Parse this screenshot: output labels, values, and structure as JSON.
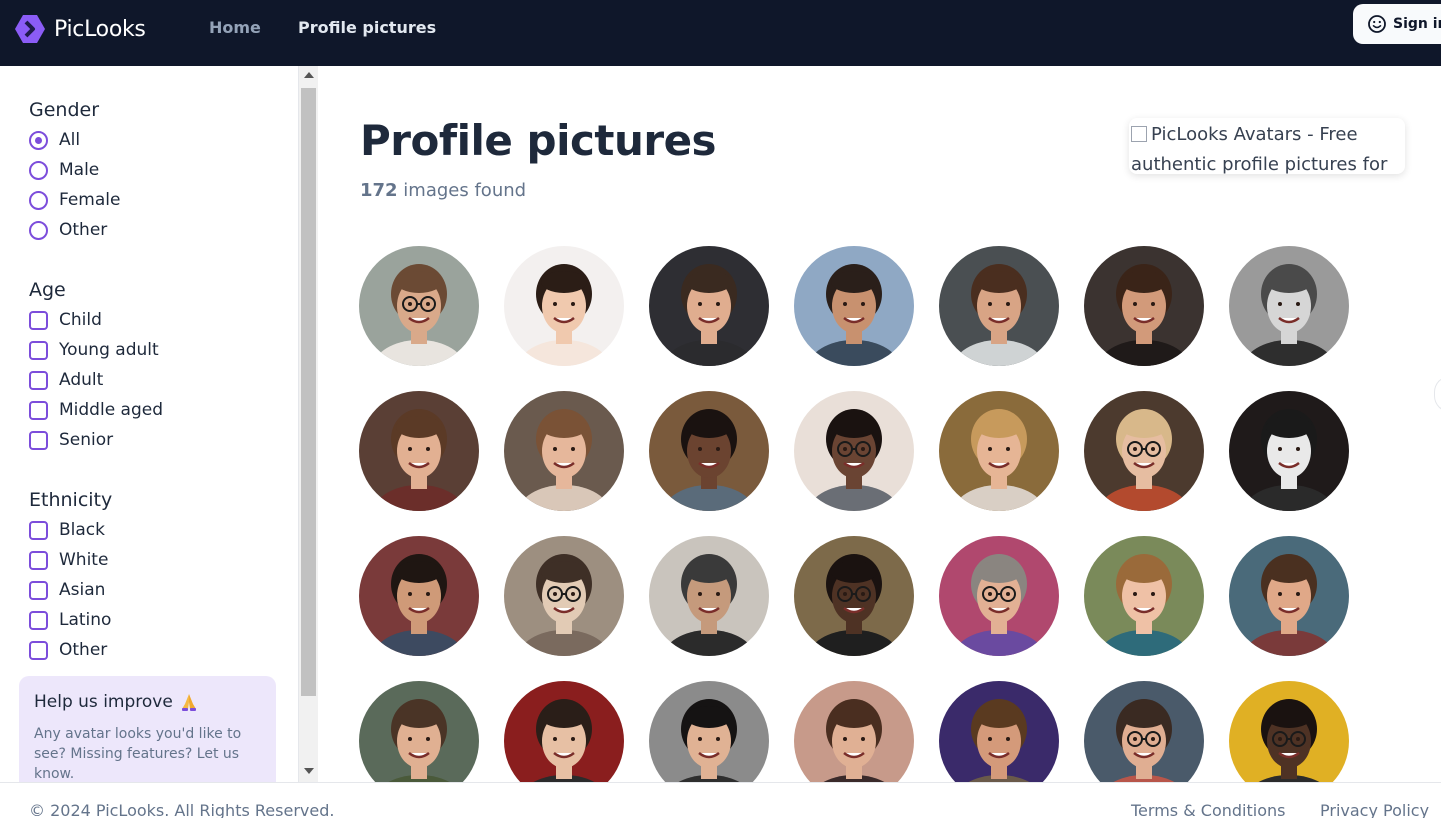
{
  "header": {
    "brand": "PicLooks",
    "nav": [
      {
        "label": "Home"
      },
      {
        "label": "Profile pictures"
      }
    ],
    "signin_label": "Sign in"
  },
  "sidebar": {
    "gender": {
      "title": "Gender",
      "options": [
        "All",
        "Male",
        "Female",
        "Other"
      ],
      "selected": "All"
    },
    "age": {
      "title": "Age",
      "options": [
        "Child",
        "Young adult",
        "Adult",
        "Middle aged",
        "Senior"
      ]
    },
    "ethnicity": {
      "title": "Ethnicity",
      "options": [
        "Black",
        "White",
        "Asian",
        "Latino",
        "Other"
      ]
    },
    "help": {
      "title": "Help us improve",
      "text": "Any avatar looks you'd like to see? Missing features? Let us know."
    }
  },
  "main": {
    "title": "Profile pictures",
    "count": "172",
    "count_suffix": " images found",
    "broken_image_alt": "PicLooks Avatars - Free authentic profile pictures for"
  },
  "avatars": [
    {
      "bg": "#9aa39c",
      "skin": "#d9a98a",
      "hair": "#6b4a34",
      "shirt": "#e8e4df",
      "glasses": true
    },
    {
      "bg": "#f3f0ef",
      "skin": "#f0c9ae",
      "hair": "#2b1d16",
      "shirt": "#f5e6dc",
      "glasses": false
    },
    {
      "bg": "#2e2e33",
      "skin": "#e0ad8f",
      "hair": "#3a2a20",
      "shirt": "#2b2b2e",
      "glasses": false
    },
    {
      "bg": "#8fa8c4",
      "skin": "#c8916f",
      "hair": "#2a1f1a",
      "shirt": "#3a4b5d",
      "glasses": false
    },
    {
      "bg": "#4a4f52",
      "skin": "#d8a485",
      "hair": "#4a2e1f",
      "shirt": "#cfd3d4",
      "glasses": false
    },
    {
      "bg": "#3b3330",
      "skin": "#d29a7a",
      "hair": "#3a2418",
      "shirt": "#1f1a19",
      "glasses": false
    },
    {
      "bg": "#9a9a9a",
      "skin": "#d6d6d6",
      "hair": "#4a4a4a",
      "shirt": "#2e2e2e",
      "glasses": false
    },
    {
      "bg": "#5a3f35",
      "skin": "#e2b092",
      "hair": "#5b3a26",
      "shirt": "#6b2e2a",
      "glasses": false
    },
    {
      "bg": "#6a5a4e",
      "skin": "#e6b79b",
      "hair": "#7a5236",
      "shirt": "#d9c7b8",
      "glasses": false
    },
    {
      "bg": "#7a5a3c",
      "skin": "#6b4330",
      "hair": "#1a1210",
      "shirt": "#5a6b7a",
      "glasses": false
    },
    {
      "bg": "#e9dfd8",
      "skin": "#6a4433",
      "hair": "#1a1210",
      "shirt": "#6a6e75",
      "glasses": true
    },
    {
      "bg": "#8a6b3b",
      "skin": "#e6b595",
      "hair": "#c79a5c",
      "shirt": "#d9cfc5",
      "glasses": false
    },
    {
      "bg": "#4c3a2e",
      "skin": "#e6bda1",
      "hair": "#d8b88a",
      "shirt": "#b34a2e",
      "glasses": true
    },
    {
      "bg": "#1f1a1a",
      "skin": "#e9e9e9",
      "hair": "#1a1a1a",
      "shirt": "#2a2a2a",
      "glasses": false
    },
    {
      "bg": "#7a3a3a",
      "skin": "#cf9a78",
      "hair": "#1f1612",
      "shirt": "#3d4a60",
      "glasses": false
    },
    {
      "bg": "#9d8f80",
      "skin": "#e2cbb5",
      "hair": "#3e2f26",
      "shirt": "#7a6a5e",
      "glasses": true
    },
    {
      "bg": "#c9c4bd",
      "skin": "#c59a7c",
      "hair": "#3a3a3a",
      "shirt": "#2b2b2b",
      "glasses": false
    },
    {
      "bg": "#7d6a4a",
      "skin": "#4e3224",
      "hair": "#1a1210",
      "shirt": "#1f1f1f",
      "glasses": true
    },
    {
      "bg": "#b0486e",
      "skin": "#e2b094",
      "hair": "#8a8580",
      "shirt": "#6a4aa0",
      "glasses": true
    },
    {
      "bg": "#7a8a5a",
      "skin": "#efc1a6",
      "hair": "#9a6a3a",
      "shirt": "#2e6b7a",
      "glasses": false
    },
    {
      "bg": "#4a6a7a",
      "skin": "#e0a888",
      "hair": "#4a3020",
      "shirt": "#7a3a3a",
      "glasses": false
    },
    {
      "bg": "#5a6a5a",
      "skin": "#e0b092",
      "hair": "#4a3426",
      "shirt": "#4a5a3a",
      "glasses": false
    },
    {
      "bg": "#8a1e1e",
      "skin": "#e7c0a4",
      "hair": "#2a1e18",
      "shirt": "#2b2b2b",
      "glasses": false
    },
    {
      "bg": "#8b8b8b",
      "skin": "#e0b294",
      "hair": "#151313",
      "shirt": "#2e2e2e",
      "glasses": false
    },
    {
      "bg": "#c79a8a",
      "skin": "#e0b094",
      "hair": "#4a2e20",
      "shirt": "#3a2a2a",
      "glasses": false
    },
    {
      "bg": "#3a2a6a",
      "skin": "#d49a7a",
      "hair": "#5a3a20",
      "shirt": "#6a5a4a",
      "glasses": false
    },
    {
      "bg": "#4a5a6a",
      "skin": "#e0ae92",
      "hair": "#3a2a22",
      "shirt": "#b8564a",
      "glasses": true
    },
    {
      "bg": "#e0b024",
      "skin": "#4e3224",
      "hair": "#1a1210",
      "shirt": "#2b2b2b",
      "glasses": true
    }
  ],
  "footer": {
    "copyright": "© 2024 PicLooks. All Rights Reserved.",
    "terms": "Terms & Conditions",
    "privacy": "Privacy Policy"
  }
}
